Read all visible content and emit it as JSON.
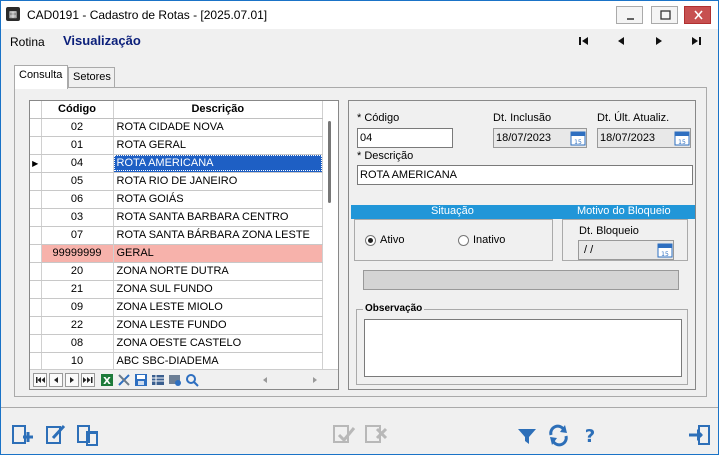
{
  "window": {
    "title": "CAD0191 - Cadastro de Rotas - [2025.07.01]",
    "icon": "app-grid-icon"
  },
  "toolbar": {
    "rotina_label": "Rotina",
    "mode_label": "Visualização",
    "nav_icons": [
      "first-record-icon",
      "previous-record-icon",
      "next-record-icon",
      "last-record-icon"
    ]
  },
  "tabs": [
    {
      "label": "Consulta",
      "active": true
    },
    {
      "label": "Setores",
      "active": false
    }
  ],
  "grid": {
    "columns": [
      "Código",
      "Descrição"
    ],
    "rows": [
      {
        "code": "02",
        "desc": "ROTA CIDADE NOVA"
      },
      {
        "code": "01",
        "desc": "ROTA GERAL"
      },
      {
        "code": "04",
        "desc": "ROTA AMERICANA",
        "selected": true
      },
      {
        "code": "05",
        "desc": "ROTA RIO DE JANEIRO"
      },
      {
        "code": "06",
        "desc": "ROTA GOIÁS"
      },
      {
        "code": "03",
        "desc": "ROTA SANTA BARBARA CENTRO"
      },
      {
        "code": "07",
        "desc": "ROTA SANTA BÁRBARA ZONA LESTE"
      },
      {
        "code": "99999999",
        "desc": "GERAL",
        "highlight": "#f7b2ab"
      },
      {
        "code": "20",
        "desc": "ZONA NORTE DUTRA"
      },
      {
        "code": "21",
        "desc": "ZONA SUL FUNDO"
      },
      {
        "code": "09",
        "desc": "ZONA LESTE MIOLO"
      },
      {
        "code": "22",
        "desc": "ZONA LESTE FUNDO"
      },
      {
        "code": "08",
        "desc": "ZONA OESTE CASTELO"
      },
      {
        "code": "10",
        "desc": "ABC  SBC-DIADEMA"
      }
    ]
  },
  "detail": {
    "codigo_label": "* Código",
    "codigo_value": "04",
    "dt_inclusao_label": "Dt. Inclusão",
    "dt_inclusao_value": "18/07/2023",
    "dt_ult_label": "Dt. Últ. Atualiz.",
    "dt_ult_value": "18/07/2023",
    "descricao_label": "* Descrição",
    "descricao_value": "ROTA AMERICANA",
    "situacao_header": "Situação",
    "motivo_header": "Motivo do Bloqueio",
    "ativo_label": "Ativo",
    "inativo_label": "Inativo",
    "situacao_selected": "Ativo",
    "dt_bloqueio_label": "Dt. Bloqueio",
    "dt_bloqueio_value": " / /",
    "observacao_label": "Observação"
  },
  "colors": {
    "accent": "#2196d8",
    "selection": "#1e5fc4",
    "special_row": "#f7b2ab",
    "mode_text": "#0b1f7a"
  }
}
